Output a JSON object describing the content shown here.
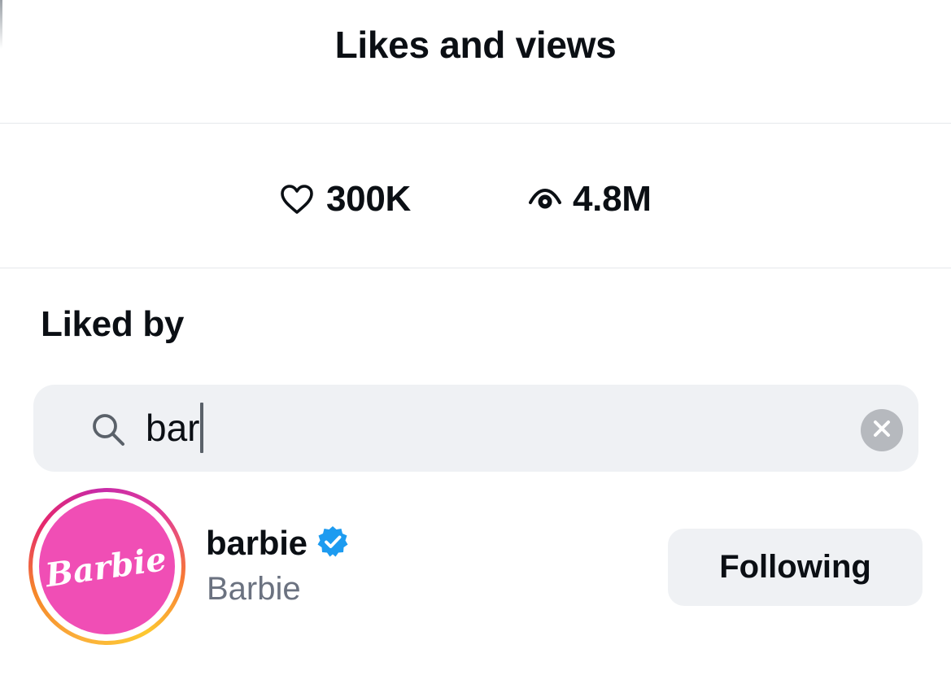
{
  "header": {
    "title": "Likes and views"
  },
  "stats": {
    "likes": {
      "icon": "heart-icon",
      "value": "300K"
    },
    "views": {
      "icon": "eye-icon",
      "value": "4.8M"
    }
  },
  "liked_by": {
    "title": "Liked by",
    "search": {
      "icon": "search-icon",
      "value": "bar",
      "clear_icon": "clear-icon"
    },
    "results": [
      {
        "username": "barbie",
        "full_name": "Barbie",
        "verified": true,
        "avatar_logo_text": "Barbie",
        "button_label": "Following"
      }
    ]
  },
  "colors": {
    "text": "#0b0f14",
    "secondary_text": "#6b7280",
    "search_bg": "#eff1f4",
    "verified_badge": "#1d9bf0",
    "avatar_bg": "#f04eb5"
  }
}
